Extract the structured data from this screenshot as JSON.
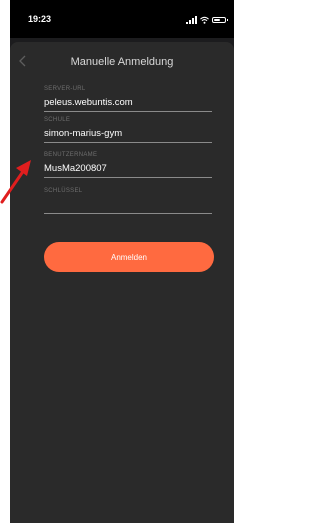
{
  "status_bar": {
    "time": "19:23",
    "icons": [
      "signal-icon",
      "wifi-icon",
      "battery-icon"
    ],
    "battery_level": 0.55
  },
  "header": {
    "title": "Manuelle Anmeldung",
    "back_icon": "chevron-left-icon"
  },
  "form": {
    "server_url": {
      "label": "SERVER-URL",
      "value": "peleus.webuntis.com"
    },
    "school": {
      "label": "SCHULE",
      "value": "simon-marius-gym"
    },
    "username": {
      "label": "BENUTZERNAME",
      "value": "MusMa200807"
    },
    "key": {
      "label": "SCHLÜSSEL",
      "value": ""
    }
  },
  "login_button": {
    "label": "Anmelden"
  },
  "colors": {
    "background": "#2a2a2a",
    "status_bar": "#000000",
    "accent": "#ff6a40",
    "annotation_arrow": "#e01e1e"
  },
  "annotation": {
    "icon": "red-arrow-icon"
  }
}
